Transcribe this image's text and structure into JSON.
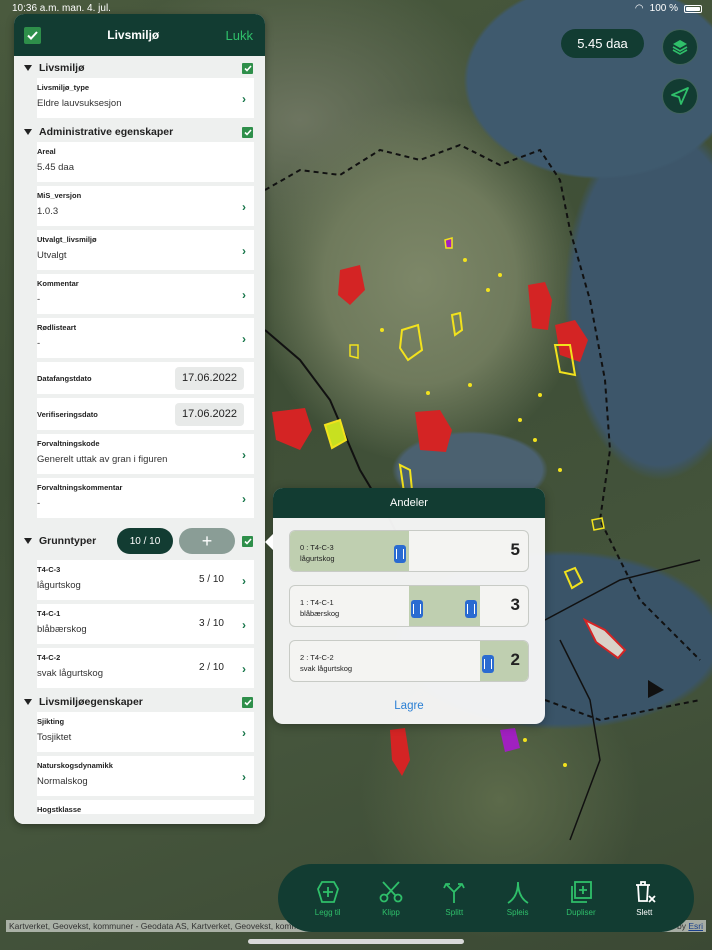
{
  "status": {
    "time": "10:36 a.m.",
    "day": "man. 4. jul.",
    "battery": "100 %"
  },
  "map": {
    "area_label": "5.45 daa",
    "attribution": "Kartverket, Geovekst, kommuner - Geodata AS, Kartverket, Geovekst, kommuner - Geodata AS",
    "attribution_right_prefix": "ed by",
    "attribution_right_link": "Esri"
  },
  "panel": {
    "title": "Livsmiljø",
    "close_label": "Lukk",
    "section_livsmiljo": "Livsmiljø",
    "livsmiljo_type_label": "Livsmiljø_type",
    "livsmiljo_type_value": "Eldre lauvsuksesjon",
    "section_admin": "Administrative egenskaper",
    "areal_label": "Areal",
    "areal_value": "5.45 daa",
    "mis_label": "MiS_versjon",
    "mis_value": "1.0.3",
    "utvalgt_label": "Utvalgt_livsmiljø",
    "utvalgt_value": "Utvalgt",
    "kommentar_label": "Kommentar",
    "kommentar_value": "-",
    "rodliste_label": "Rødlisteart",
    "rodliste_value": "-",
    "datafangst_label": "Datafangstdato",
    "datafangst_value": "17.06.2022",
    "verifisering_label": "Verifiseringsdato",
    "verifisering_value": "17.06.2022",
    "forvaltningskode_label": "Forvaltningskode",
    "forvaltningskode_value": "Generelt uttak av gran i figuren",
    "forvaltningskommentar_label": "Forvaltningskommentar",
    "forvaltningskommentar_value": "-",
    "section_grunntyper": "Grunntyper",
    "grunntyper_count": "10 / 10",
    "add_symbol": "+",
    "grunntyper": [
      {
        "code": "T4-C-3",
        "name": "lågurtskog",
        "fraction": "5 / 10"
      },
      {
        "code": "T4-C-1",
        "name": "blåbærskog",
        "fraction": "3 / 10"
      },
      {
        "code": "T4-C-2",
        "name": "svak lågurtskog",
        "fraction": "2 / 10"
      }
    ],
    "section_egenskaper": "Livsmiljøegenskaper",
    "sjikting_label": "Sjikting",
    "sjikting_value": "Tosjiktet",
    "dynamikk_label": "Naturskogsdynamikk",
    "dynamikk_value": "Normalskog",
    "hogstklasse_label": "Hogstklasse"
  },
  "andeler": {
    "title": "Andeler",
    "rows": [
      {
        "line1": "0 : T4-C-3",
        "line2": "lågurtskog",
        "value": "5",
        "start": 0.0,
        "end": 0.5
      },
      {
        "line1": "1 : T4-C-1",
        "line2": "blåbærskog",
        "value": "3",
        "start": 0.5,
        "end": 0.8
      },
      {
        "line1": "2 : T4-C-2",
        "line2": "svak lågurtskog",
        "value": "2",
        "start": 0.8,
        "end": 1.0
      }
    ],
    "save_label": "Lagre"
  },
  "toolbar": {
    "legg_til": "Legg til",
    "klipp": "Klipp",
    "splitt": "Splitt",
    "spleis": "Spleis",
    "dupliser": "Dupliser",
    "slett": "Slett"
  },
  "colors": {
    "dark_green": "#123c32",
    "accent_green": "#2fbf6a",
    "check_green": "#2e8f4a",
    "link_blue": "#2a7fd4"
  },
  "icons": [
    "layers-icon",
    "navigate-arrow-icon",
    "checkbox-checked-icon",
    "chevron-right-icon",
    "disclosure-triangle-icon",
    "slider-knob-icon",
    "add-polygon-icon",
    "scissors-icon",
    "split-icon",
    "splice-icon",
    "duplicate-icon",
    "trash-icon"
  ]
}
